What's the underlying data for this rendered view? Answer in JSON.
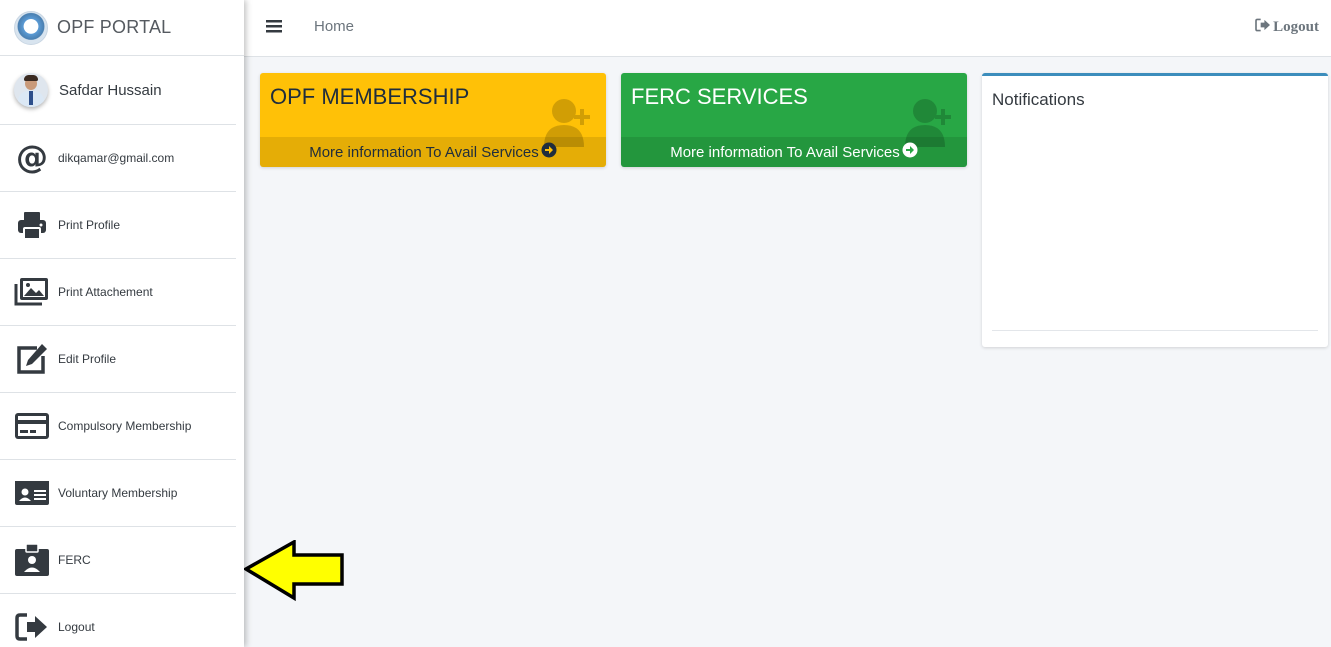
{
  "brand": {
    "title": "OPF PORTAL"
  },
  "user": {
    "name": "Safdar Hussain"
  },
  "sidebar": {
    "items": [
      {
        "label": "dikqamar@gmail.com",
        "icon": "at-icon"
      },
      {
        "label": "Print Profile",
        "icon": "print-icon"
      },
      {
        "label": "Print Attachement",
        "icon": "images-icon"
      },
      {
        "label": "Edit Profile",
        "icon": "edit-icon"
      },
      {
        "label": "Compulsory Membership",
        "icon": "credit-card-icon"
      },
      {
        "label": "Voluntary Membership",
        "icon": "id-card-icon"
      },
      {
        "label": "FERC",
        "icon": "id-badge-icon"
      },
      {
        "label": "Logout",
        "icon": "sign-out-icon"
      }
    ]
  },
  "topbar": {
    "home": "Home",
    "logout": "Logout"
  },
  "cards": {
    "opf": {
      "title": "OPF MEMBERSHIP",
      "footer": "More information To Avail Services",
      "color": "#ffc107"
    },
    "ferc": {
      "title": "FERC SERVICES",
      "footer": "More information To Avail Services",
      "color": "#28a745"
    }
  },
  "notifications": {
    "title": "Notifications"
  },
  "annotation": {
    "arrow_color": "#ffff00"
  }
}
